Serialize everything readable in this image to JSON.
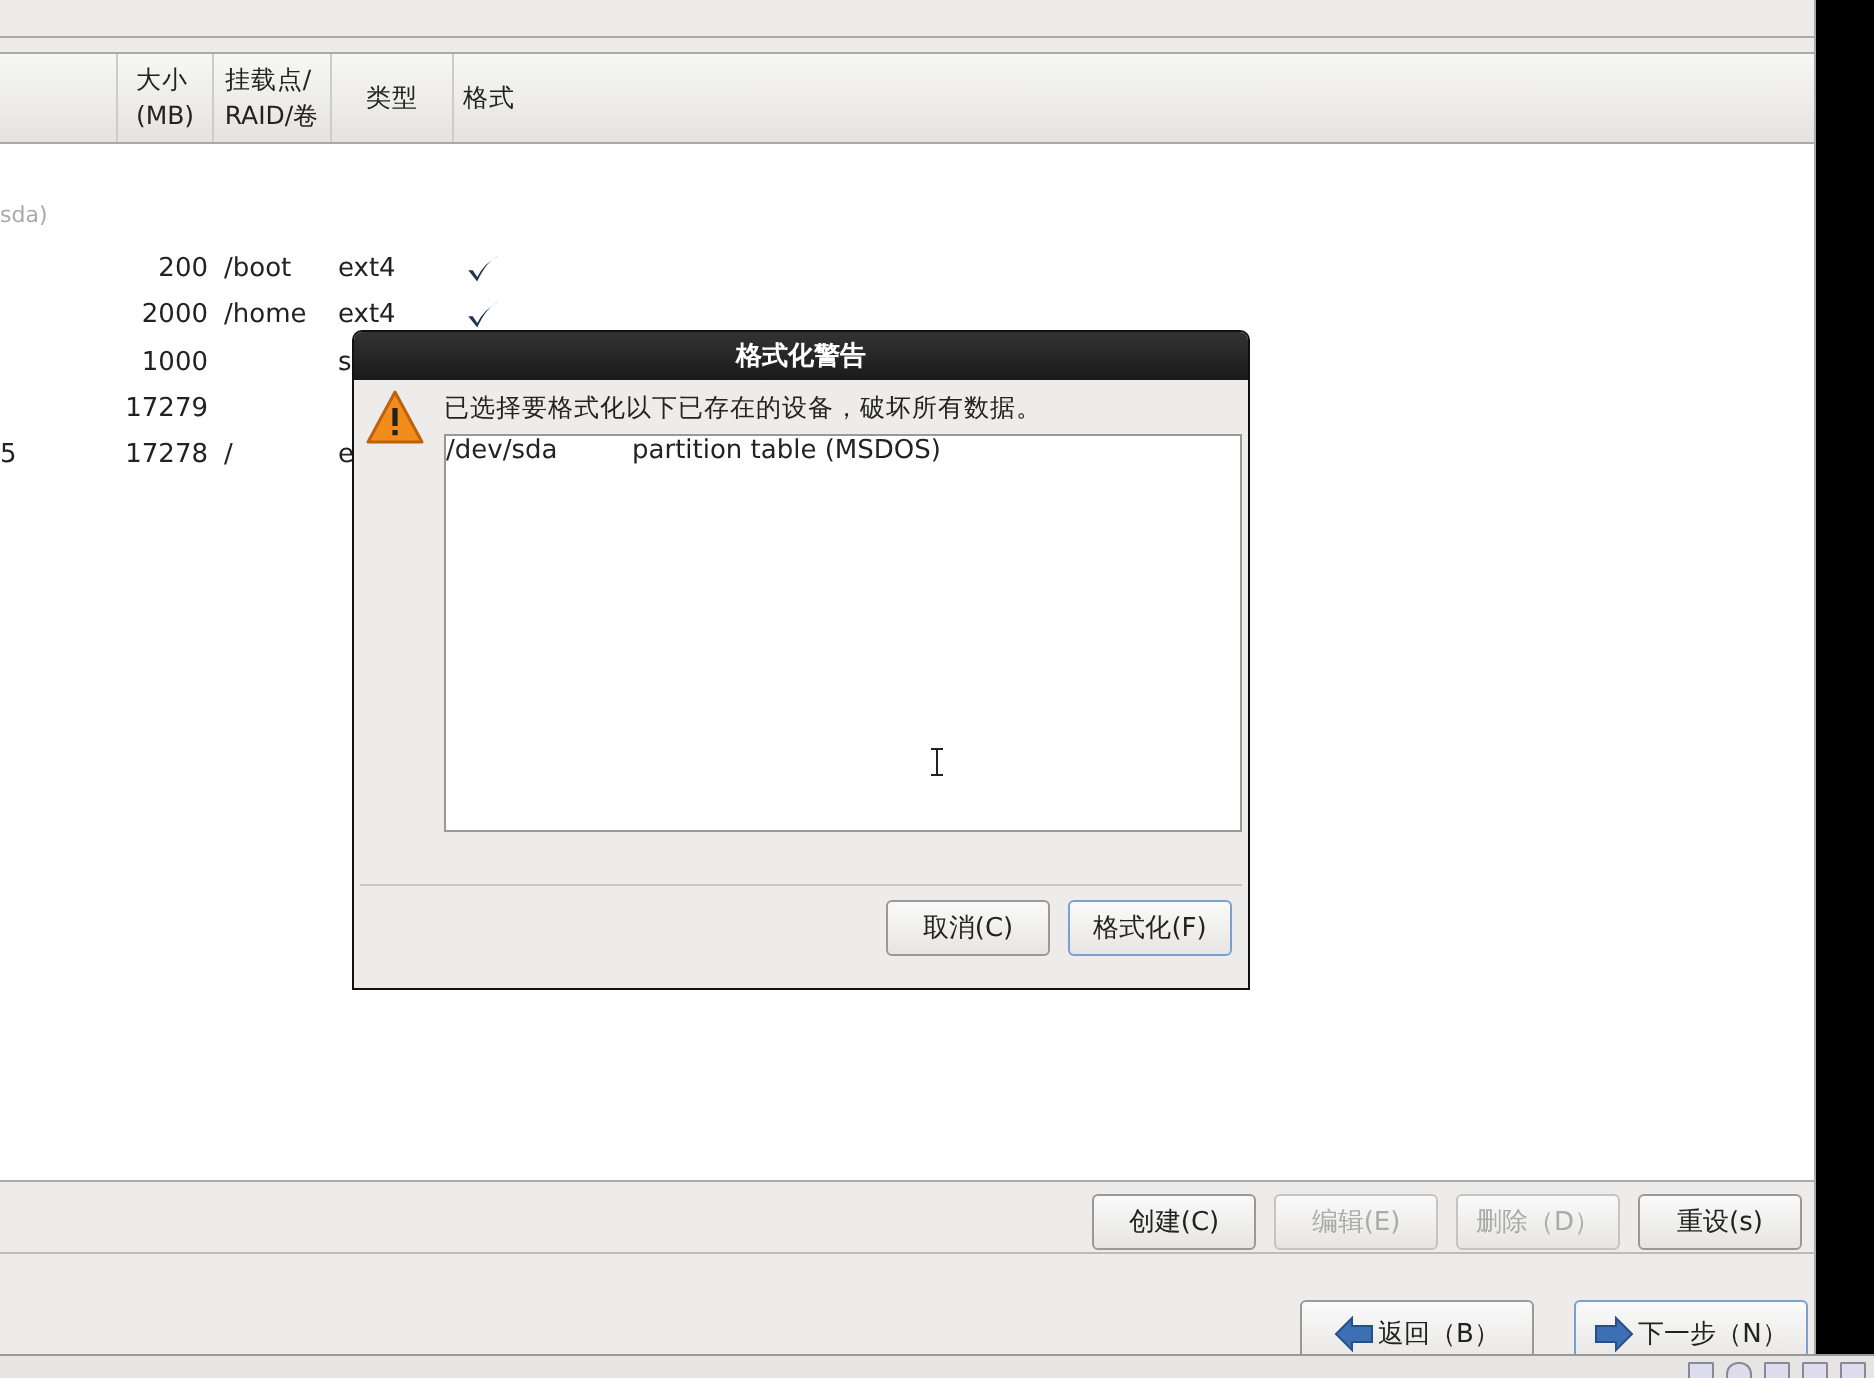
{
  "table": {
    "columns": [
      {
        "label": "大小\n(MB)"
      },
      {
        "label": "挂载点/\nRAID/卷"
      },
      {
        "label": "类型"
      },
      {
        "label": "格式"
      }
    ],
    "disk_label": "sda)",
    "rows": [
      {
        "device": "",
        "size": "200",
        "mount": "/boot",
        "type": "ext4",
        "format": true
      },
      {
        "device": "",
        "size": "2000",
        "mount": "/home",
        "type": "ext4",
        "format": true
      },
      {
        "device": "",
        "size": "1000",
        "mount": "",
        "type": "s"
      },
      {
        "device": "",
        "size": "17279",
        "mount": "",
        "type": ""
      },
      {
        "device": "5",
        "size": "17278",
        "mount": "/",
        "type": "e"
      }
    ]
  },
  "actions": [
    {
      "label": "创建(C)",
      "disabled": false
    },
    {
      "label": "编辑(E)",
      "disabled": true
    },
    {
      "label": "删除（D）",
      "disabled": true
    },
    {
      "label": "重设(s)",
      "disabled": false
    }
  ],
  "nav": [
    {
      "label": "返回（B）",
      "kind": "back",
      "focused": false
    },
    {
      "label": "下一步（N）",
      "kind": "next",
      "focused": true
    }
  ],
  "dialog": {
    "title": "格式化警告",
    "message": "已选择要格式化以下已存在的设备，破坏所有数据。",
    "devices": [
      {
        "device": "/dev/sda",
        "description": "partition table (MSDOS)"
      }
    ],
    "buttons": [
      {
        "label": "取消(C)",
        "focused": false
      },
      {
        "label": "格式化(F)",
        "focused": true
      }
    ]
  }
}
